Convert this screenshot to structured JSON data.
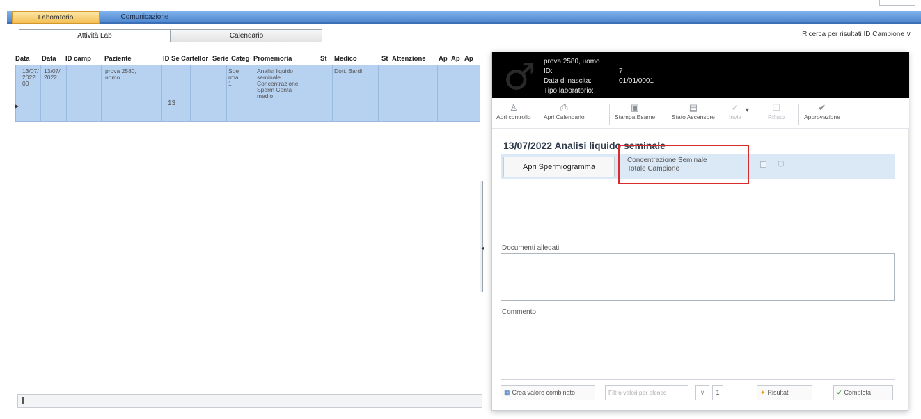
{
  "main_tabs": {
    "active": "Laboratorio",
    "inactive": "Comunicazione"
  },
  "sub_tabs": {
    "active": "Attività Lab",
    "inactive": "Calendario"
  },
  "search_label": "Ricerca per risultati ID Campione ∨",
  "grid": {
    "headers": [
      "Data",
      "Data",
      "ID camp",
      "Paziente",
      "ID",
      "Se",
      "Cartellor",
      "Serie",
      "Categ",
      "Promemoria",
      "St",
      "Medico",
      "St",
      "Attenzione",
      "Ap",
      "Ap",
      "Ap"
    ],
    "row": {
      "data1": "13/07/\n2022\n00",
      "data2": "13/07/\n2022",
      "paziente": "prova 2580,\nuomo",
      "se": "13",
      "serie": "Spe\nrma\n1",
      "promemoria": "Analisi liquido\nseminale\nConcentrazione\nSperm Conta\nmedio",
      "medico": "Dott. Bardi",
      "mark": "▶"
    }
  },
  "panel": {
    "patient_name": "prova 2580, uomo",
    "id_label": "ID:",
    "id_value": "7",
    "dob_label": "Data di nascita:",
    "dob_value": "01/01/0001",
    "type_label": "Tipo laboratorio:",
    "gender_icon": "♂",
    "toolbar": [
      {
        "label": "Apri controllo",
        "icon": "person-icon"
      },
      {
        "label": "Apri Calendario",
        "icon": "printer-icon"
      },
      {
        "label": "Stampa Esame",
        "icon": "print-preview-icon"
      },
      {
        "label": "Stato Ascensore",
        "icon": "document-icon"
      },
      {
        "label": "Invia",
        "icon": "send-icon"
      },
      {
        "label": "Rifiuto",
        "icon": "reject-icon"
      },
      {
        "label": "Approvazione",
        "icon": "check-icon"
      }
    ],
    "title": "13/07/2022   Analisi liquido seminale",
    "apri_button": "Apri Spermiogramma",
    "link_text": "Concentrazione Seminale\nTotale Campione",
    "commenti_label": "Documenti allegati",
    "commento_label": "Commento",
    "footer": {
      "btn1": "Crea valore combinato",
      "select_placeholder": "Filtro valori per elenco",
      "num": "1",
      "btn2": "Risultati",
      "btn3": "Completa"
    }
  }
}
